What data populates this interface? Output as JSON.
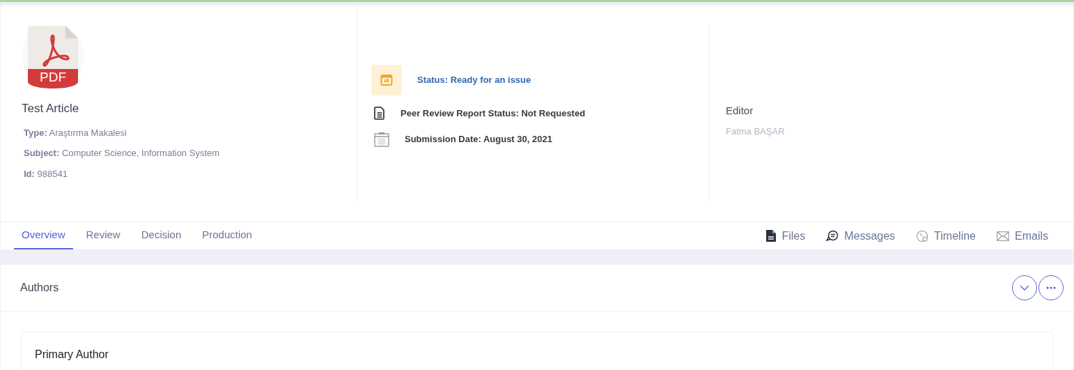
{
  "article": {
    "file_type": "PDF",
    "title": "Test Article",
    "meta": [
      "**Type:** Araştırma Makalesi",
      "**Subject:** Computer Science, Information System",
      "**Id:** 988541"
    ]
  },
  "status_items": [
    {
      "kind": "status",
      "text": "Status: Ready for an issue"
    },
    {
      "kind": "report",
      "text": "Peer Review Report Status: Not Requested"
    },
    {
      "kind": "date",
      "text": "Submission Date: August 30, 2021"
    }
  ],
  "editor": {
    "label": "Editor",
    "name": "Fatma BAŞAR"
  },
  "tabs": [
    {
      "label": "Overview",
      "selected": true
    },
    {
      "label": "Review",
      "selected": false
    },
    {
      "label": "Decision",
      "selected": false
    },
    {
      "label": "Production",
      "selected": false
    }
  ],
  "actions": [
    {
      "kind": "files",
      "label": "Files"
    },
    {
      "kind": "messages",
      "label": "Messages"
    },
    {
      "kind": "timeline",
      "label": "Timeline"
    },
    {
      "kind": "emails",
      "label": "Emails"
    }
  ],
  "authors_panel": {
    "title": "Authors",
    "primary_heading": "Primary Author"
  }
}
